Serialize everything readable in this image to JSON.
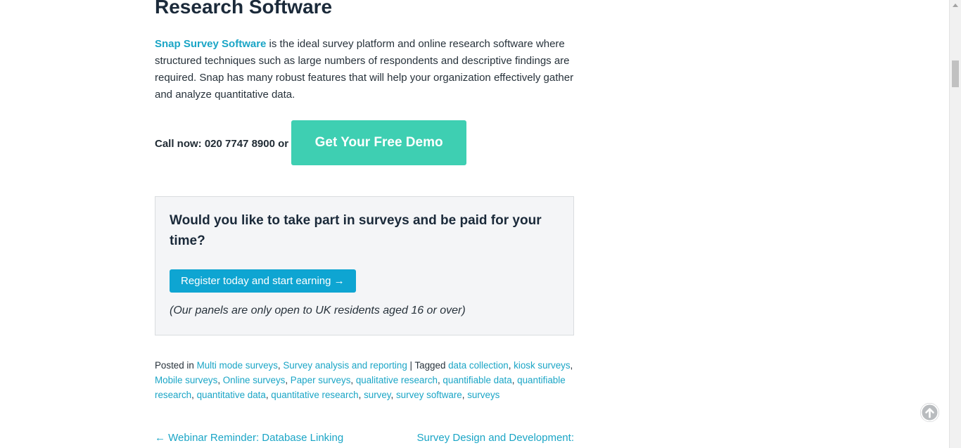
{
  "article": {
    "heading": "Research Software",
    "intro_link": "Snap Survey Software",
    "intro_text": " is the ideal survey platform and online research software where structured techniques such as large numbers of respondents and descriptive findings are required. Snap has many robust features that will help your organization effectively gather and analyze quantitative data."
  },
  "cta": {
    "call_text": "Call now: 020 7747 8900 or",
    "demo_button": "Get Your Free Demo"
  },
  "panel": {
    "question": "Would you like to take part in surveys and be paid for your time?",
    "register_button": "Register today and start earning →",
    "note": "(Our panels are only open to UK residents aged 16 or over)"
  },
  "meta": {
    "posted_in_label": "Posted in ",
    "categories": [
      "Multi mode surveys",
      "Survey analysis and reporting"
    ],
    "tagged_label": " | Tagged ",
    "tags": [
      "data collection",
      "kiosk surveys",
      "Mobile surveys",
      "Online surveys",
      "Paper surveys",
      "qualitative research",
      "quantifiable data",
      "quantifiable research",
      "quantitative data",
      "quantitative research",
      "survey",
      "survey software",
      "surveys"
    ]
  },
  "post_nav": {
    "prev": "← Webinar Reminder: Database Linking",
    "next": "Survey Design and Development:"
  },
  "icons": {
    "scroll_top": "arrow-up-circle-icon"
  },
  "colors": {
    "link": "#1aa5c6",
    "demo_button": "#3ecfb2",
    "register_button": "#0ea5d2"
  }
}
